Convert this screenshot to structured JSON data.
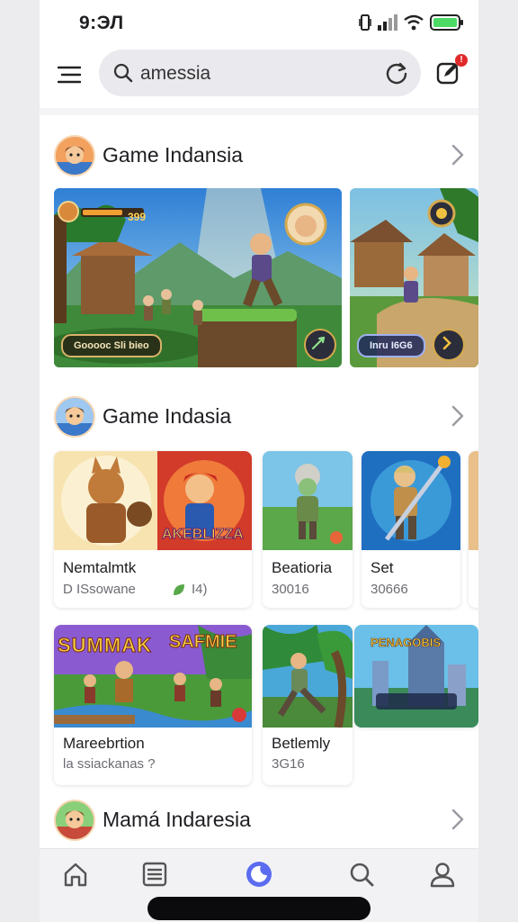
{
  "status_bar": {
    "time": "9:ЭЛ"
  },
  "search": {
    "value": "amessia",
    "placeholder": "Search"
  },
  "notifications": {
    "badge": "!"
  },
  "sections": [
    {
      "title": "Game Indansia"
    },
    {
      "title": "Game Indasia"
    },
    {
      "title": "Mamá Indaresia"
    }
  ],
  "banners": [
    {
      "hud_value": "399",
      "cta": "Gooooc Sli bieo"
    },
    {
      "cta": "Inru I6G6"
    }
  ],
  "cards_row1": [
    {
      "title": "Nemtalmtk",
      "sub": "D ISsowane",
      "sub_extra": "I4)",
      "art_label": "AKEBLIZZA"
    },
    {
      "title": "Beatioria",
      "sub": "30016"
    },
    {
      "title": "Set",
      "sub": "30666"
    }
  ],
  "cards_row2": [
    {
      "title": "Mareebrtion",
      "sub": "la ssiackanas ?",
      "art_label_1": "SUMMAK",
      "art_label_2": "SAFMIE"
    },
    {
      "title": "Betlemly",
      "sub": "3G16"
    },
    {
      "title": "",
      "sub": "",
      "art_label": "PENAGOBIS"
    }
  ],
  "bottom_nav": [
    "home",
    "feed",
    "games",
    "search",
    "profile"
  ],
  "colors": {
    "accent": "#5b6cf0",
    "badge": "#e02a2a",
    "battery": "#4cd964"
  }
}
